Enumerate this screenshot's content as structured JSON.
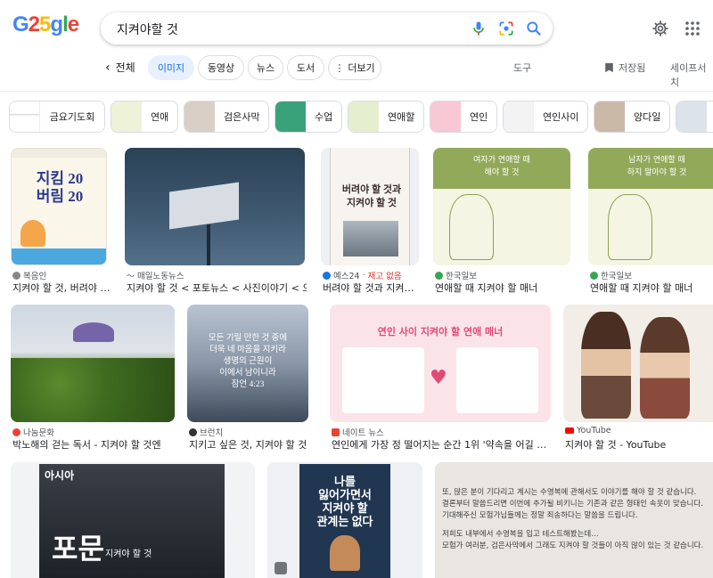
{
  "logo": {
    "text1": "G",
    "digit1": "2",
    "digit2": "5",
    "rest_g": "g",
    "rest_l": "l",
    "rest_e": "e"
  },
  "search": {
    "query": "지켜야할 것"
  },
  "tabs": {
    "back_label": "전체",
    "items": [
      "이미지",
      "동영상",
      "뉴스",
      "도서",
      "더보기"
    ],
    "tools": "도구",
    "saved": "저장됨",
    "safesearch": "세이프서치"
  },
  "related": [
    "금요기도회",
    "연애",
    "검은사막",
    "수업",
    "연애할",
    "연인",
    "연인사이",
    "양다일"
  ],
  "results": [
    {
      "source": "복음인",
      "title": "지켜야 할 것, 버려야 …",
      "cover_line1": "지킴 20",
      "cover_line2": "버림 20"
    },
    {
      "source": "매일노동뉴스",
      "title": "지켜야 할 것 < 포토뉴스 < 사진이야기 < 오…"
    },
    {
      "source": "예스24",
      "stock": "재고 없음",
      "title": "버려야 할 것과 지켜…",
      "cover_line1": "버려야 할 것과",
      "cover_line2": "지켜야 할 것"
    },
    {
      "source": "한국일보",
      "title": "연애할 때 지켜야 할 매너",
      "cover_line1": "여자가 연애할 때",
      "cover_line2": "해야 할 것"
    },
    {
      "source": "한국일보",
      "title": "연애할 때 지켜야 할 매너",
      "cover_line1": "남자가 연애할 때",
      "cover_line2": "하지 말아야 할 것"
    },
    {
      "source": "나눔문화",
      "title": "박노해의 걷는 독서 - 지켜야 할 것엔"
    },
    {
      "source": "브런치",
      "title": "지키고 싶은 것, 지켜야 할 것",
      "cover_line1": "모든 기릴 만한 것 중에",
      "cover_line2": "더욱 네 마음을 지키라",
      "cover_line3": "생명의 근원이",
      "cover_line4": "이에서 남이니라",
      "cover_line5": "잠언 4:23"
    },
    {
      "source": "네이트 뉴스",
      "title": "연인에게 가장 정 떨어지는 순간 1위 '약속을 어길 …",
      "cover_line1": "연인 사이 지켜야 할 연애 매너"
    },
    {
      "source": "YouTube",
      "title": "지켜야 할 것 - YouTube"
    },
    {
      "title": "",
      "cover_line1": "포문",
      "cover_line2": "지켜야 할 것",
      "cover_line3": "아시아"
    },
    {
      "title": "",
      "cover_line1": "나를",
      "cover_line2": "잃어가면서",
      "cover_line3": "지켜야 할",
      "cover_line4": "관계는 없다"
    },
    {
      "title": "",
      "cover_line1": "또, 많은 분이 기다리고 계시는 수영복에 관해서도 이야기를 해야 할 것 같습니다.",
      "cover_line2": "결론부터 말씀드리면 이번에 추가될 비키니는 기존과 같은 형태인 속옷이 맞습니다.",
      "cover_line3": "기대해주신 모험가님들께는 정말 죄송하다는 말씀을 드립니다.",
      "cover_line4": "저희도 내부에서 수영복을 입고 테스트해봤는데…",
      "cover_line5": "모험가 여러분, 검은사막에서 그래도 지켜야 할 것들이 아직 많이 있는 것 같습니다."
    }
  ],
  "colors": {
    "accent": "#1a73e8",
    "chip_active_bg": "#e8f0fe",
    "stock": "#d93025"
  }
}
